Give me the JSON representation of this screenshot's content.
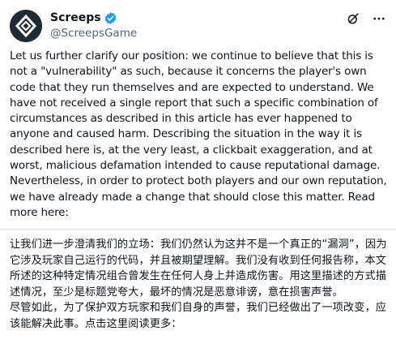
{
  "author": {
    "display_name": "Screeps",
    "handle": "@ScreepsGame",
    "avatar_icon": "screeps-logo-icon",
    "verified_icon": "verified-badge-icon",
    "verified_color": "#1d9bf0",
    "avatar_bg": "#1f2a33"
  },
  "actions": {
    "grok_icon": "grok-icon",
    "more_icon": "more-options-icon"
  },
  "tweet": {
    "paragraph_1": "Let us further clarify our position: we continue to believe that this is not a \"vulnerability\" as such, because it concerns the player's own code that they run themselves and are expected to understand. We have not received a single report that such a specific combination of circumstances as described in this article has ever happened to anyone and caused harm. Describing the situation in the way it is described here is, at the very least, a clickbait exaggeration, and at worst, malicious defamation intended to cause reputational damage.",
    "paragraph_2": "Nevertheless, in order to protect both players and our own reputation, we have already made a change that should close this matter. Read more here:"
  },
  "translation": {
    "paragraph_1": "让我们进一步澄清我们的立场：我们仍然认为这并不是一个真正的“漏洞”，因为它涉及玩家自己运行的代码，并且被期望理解。我们没有收到任何报告称，本文所述的这种特定情况组合曾发生在任何人身上并造成伤害。用这里描述的方式描述情况，至少是标题党夸大，最坏的情况是恶意诽谤，意在损害声誉。",
    "paragraph_2": "尽管如此，为了保护双方玩家和我们自身的声誉，我们已经做出了一项改变，应该能解决此事。点击这里阅读更多："
  }
}
